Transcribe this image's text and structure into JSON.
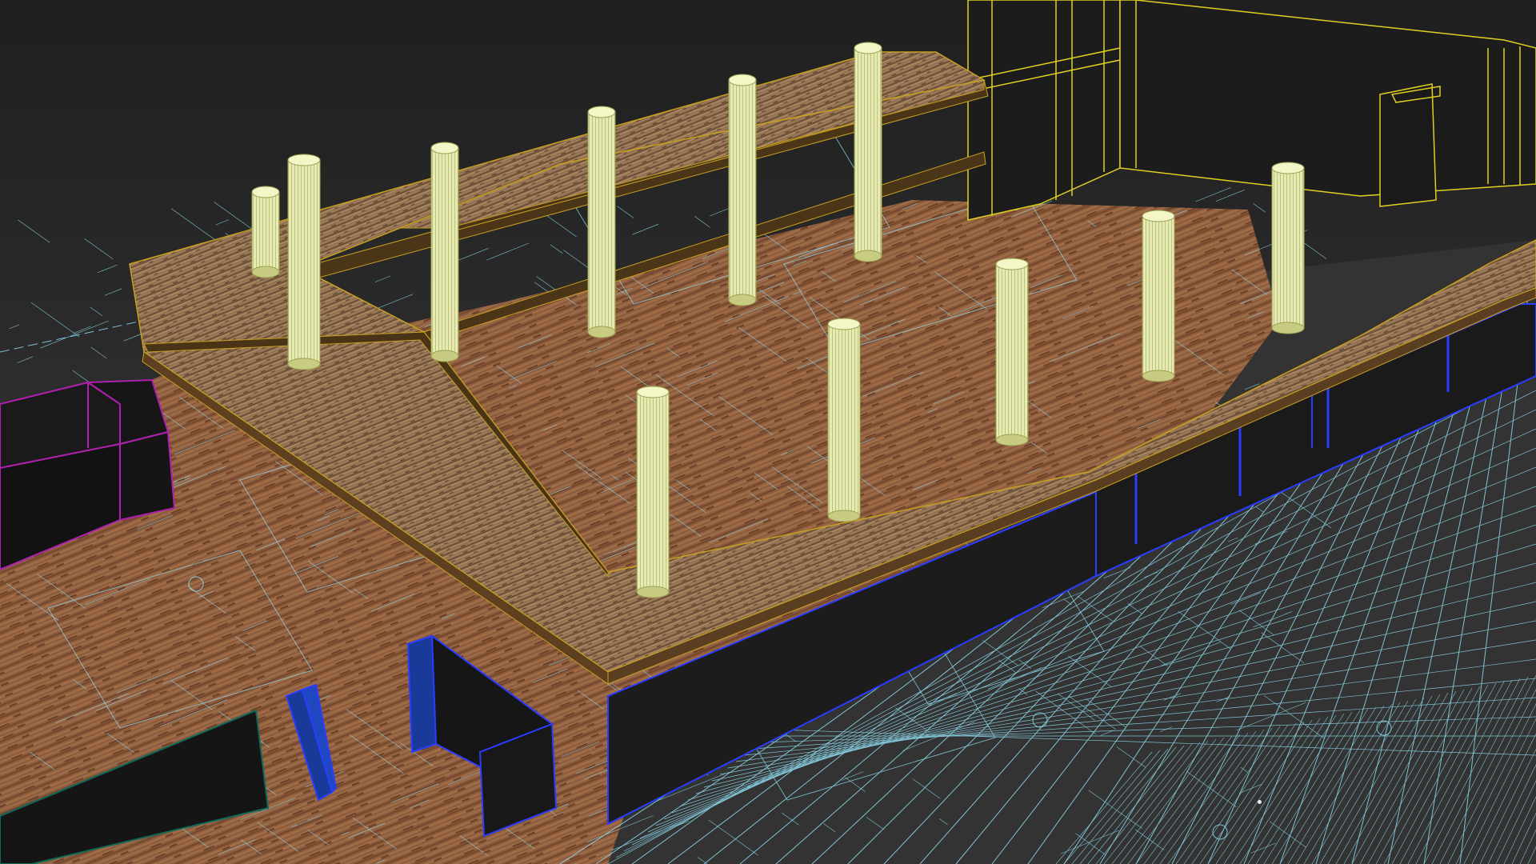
{
  "app": {
    "name": "",
    "view": "Perspective"
  },
  "colors": {
    "background_top": "#1f1f1f",
    "background_bottom": "#3a3a3a",
    "blueprint_lines": "#8fdcf0",
    "floor_wood": "#8a5a3c",
    "shelf_wood": "#8a6a48",
    "shelf_edge": "#c8a020",
    "column_fill": "#e6e8b0",
    "column_lines": "#f4f6c8",
    "wall_dark": "#1a1a1a",
    "wall_edge_blue": "#2a3cff",
    "building_outline_yellow": "#e0d020",
    "cabinet_outline_magenta": "#b020b0"
  },
  "scene": {
    "objects": [
      {
        "name": "wood-floor-plane",
        "type": "plane"
      },
      {
        "name": "cad-blueprint-overlay",
        "type": "spline-set"
      },
      {
        "name": "l-shaped-bench-top",
        "type": "box"
      },
      {
        "name": "l-shaped-bench-base",
        "type": "box"
      },
      {
        "name": "suspended-shelves",
        "type": "box-array"
      },
      {
        "name": "cylinder-columns",
        "type": "cylinder-array",
        "count": 11
      },
      {
        "name": "building-wireframe",
        "type": "line"
      },
      {
        "name": "magenta-cabinet",
        "type": "box"
      },
      {
        "name": "blue-partition-walls",
        "type": "box-array"
      }
    ]
  }
}
